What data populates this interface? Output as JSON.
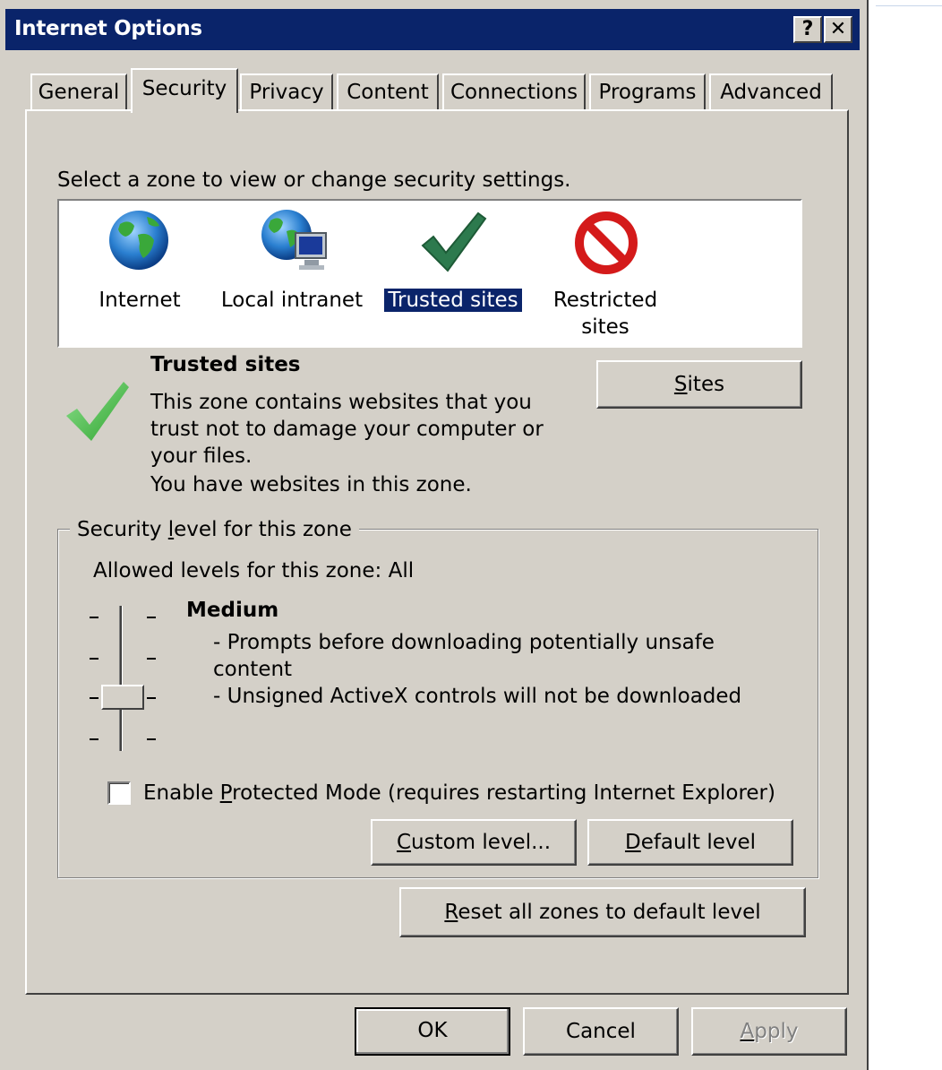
{
  "window": {
    "title": "Internet Options",
    "help_label": "?",
    "close_label": "✕"
  },
  "tabs": [
    {
      "label": "General"
    },
    {
      "label": "Security",
      "active": true
    },
    {
      "label": "Privacy"
    },
    {
      "label": "Content"
    },
    {
      "label": "Connections"
    },
    {
      "label": "Programs"
    },
    {
      "label": "Advanced"
    }
  ],
  "security": {
    "prompt": "Select a zone to view or change security settings.",
    "zones": [
      {
        "label": "Internet",
        "icon": "globe-icon"
      },
      {
        "label": "Local intranet",
        "icon": "intranet-icon"
      },
      {
        "label": "Trusted sites",
        "icon": "checkmark-icon",
        "selected": true
      },
      {
        "label_line1": "Restricted",
        "label_line2": "sites",
        "icon": "prohibited-icon"
      }
    ],
    "zone_info": {
      "title": "Trusted sites",
      "line1": "This zone contains websites that you",
      "line2": "trust not to damage your computer or",
      "line3": "your files.",
      "line4": "You have websites in this zone."
    },
    "sites_button": {
      "mnemonic": "S",
      "rest": "ites"
    },
    "group": {
      "legend_pre": "Security ",
      "legend_mn": "l",
      "legend_post": "evel for this zone",
      "allowed": "Allowed levels for this zone: All",
      "level_name": "Medium",
      "desc1": "- Prompts before downloading potentially unsafe",
      "desc2": "content",
      "desc3": "- Unsigned ActiveX controls will not be downloaded",
      "slider_level": "Medium",
      "protected_mode": {
        "pre": "Enable ",
        "mn": "P",
        "post": "rotected Mode (requires restarting Internet Explorer)",
        "checked": false
      },
      "custom_button": {
        "mn": "C",
        "rest": "ustom level..."
      },
      "default_button": {
        "mn": "D",
        "rest": "efault level"
      }
    },
    "reset_button": {
      "mn": "R",
      "rest": "eset all zones to default level"
    }
  },
  "footer": {
    "ok": "OK",
    "cancel": "Cancel",
    "apply_mn": "A",
    "apply_rest": "pply"
  },
  "colors": {
    "titlebar": "#0a246a",
    "dialog": "#d4d0c8",
    "selection": "#0a246a"
  }
}
